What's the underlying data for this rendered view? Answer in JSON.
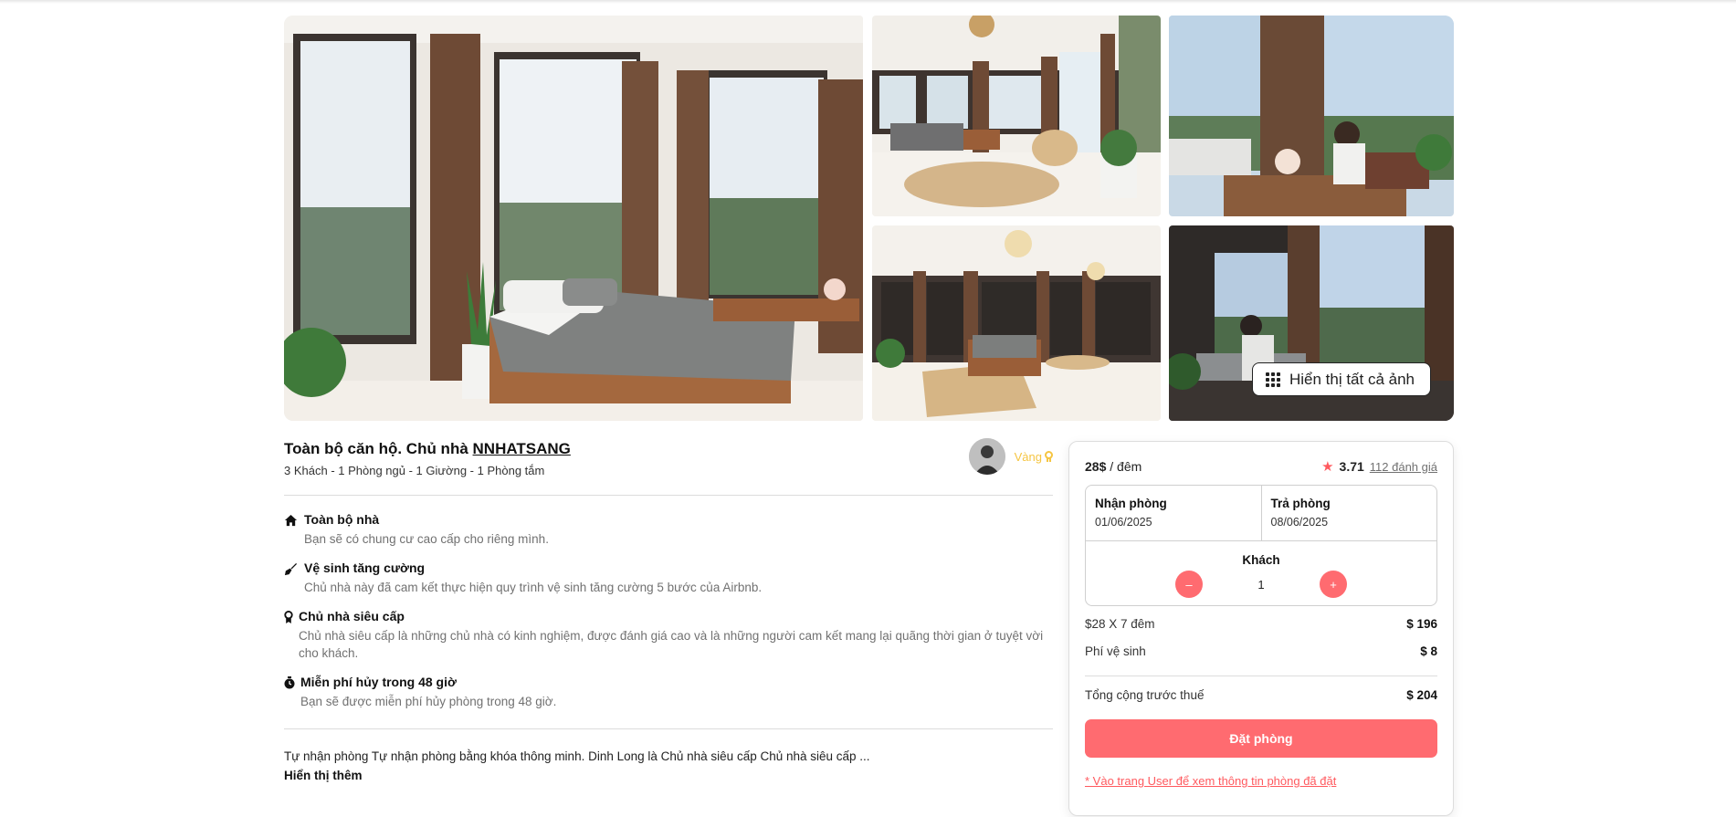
{
  "gallery": {
    "show_all_label": "Hiển thị tất cả ảnh"
  },
  "listing": {
    "title_prefix": "Toàn bộ căn hộ. Chủ nhà",
    "host_name": "NNHATSANG",
    "summary": "3 Khách - 1 Phòng ngủ - 1 Giường - 1 Phòng tắm",
    "host_badge": "Vàng"
  },
  "features": [
    {
      "icon": "home-icon",
      "title": "Toàn bộ nhà",
      "desc": "Bạn sẽ có chung cư cao cấp cho riêng mình."
    },
    {
      "icon": "broom-icon",
      "title": "Vệ sinh tăng cường",
      "desc": "Chủ nhà này đã cam kết thực hiện quy trình vệ sinh tăng cường 5 bước của Airbnb."
    },
    {
      "icon": "medal-icon",
      "title": "Chủ nhà siêu cấp",
      "desc": "Chủ nhà siêu cấp là những chủ nhà có kinh nghiệm, được đánh giá cao và là những người cam kết mang lại quãng thời gian ở tuyệt vời cho khách."
    },
    {
      "icon": "stopwatch-icon",
      "title": "Miễn phí hủy trong 48 giờ",
      "desc": "Bạn sẽ được miễn phí hủy phòng trong 48 giờ."
    }
  ],
  "description": {
    "text": "Tự nhận phòng Tự nhận phòng bằng khóa thông minh. Dinh Long là Chủ nhà siêu cấp Chủ nhà siêu cấp ...",
    "show_more": "Hiển thị thêm"
  },
  "booking": {
    "price": "28$",
    "price_unit": " / đêm",
    "rating": "3.71",
    "reviews": "112 đánh giá",
    "checkin_label": "Nhận phòng",
    "checkin_value": "01/06/2025",
    "checkout_label": "Trả phòng",
    "checkout_value": "08/06/2025",
    "guests_label": "Khách",
    "guests_count": "1",
    "minus": "–",
    "plus": "+",
    "nights_label": "$28 X 7 đêm",
    "nights_total": "$ 196",
    "cleaning_label": "Phí vệ sinh",
    "cleaning_value": "$ 8",
    "total_label": "Tổng cộng trước thuế",
    "total_value": "$ 204",
    "book_button": "Đặt phòng",
    "user_link": "* Vào trang User để xem thông tin phòng đã đặt"
  },
  "colors": {
    "accent": "#ff6b70",
    "link": "#ff5a5f",
    "badge": "#f5c542"
  }
}
